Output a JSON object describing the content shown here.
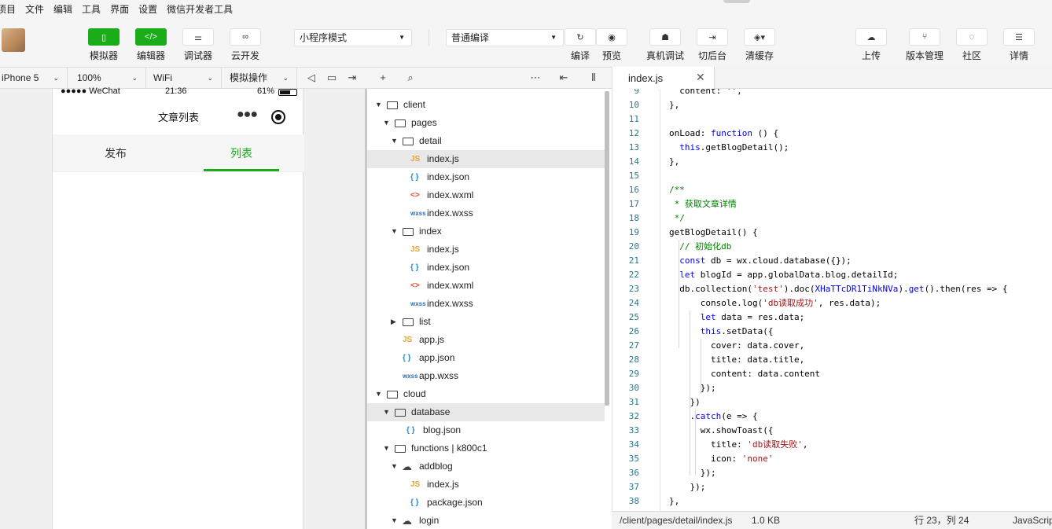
{
  "menu": [
    "项目",
    "文件",
    "编辑",
    "工具",
    "界面",
    "设置",
    "微信开发者工具"
  ],
  "toolbar": {
    "simulator": "模拟器",
    "editor": "编辑器",
    "debugger": "调试器",
    "cloud": "云开发",
    "mode": "小程序模式",
    "compile_mode": "普通编译",
    "compile": "编译",
    "preview": "预览",
    "real_debug": "真机调试",
    "background": "切后台",
    "clear_cache": "清缓存",
    "upload": "上传",
    "version": "版本管理",
    "community": "社区",
    "details": "详情"
  },
  "subbar": {
    "device": "iPhone 5",
    "zoom": "100%",
    "network": "WiFi",
    "operation": "模拟操作"
  },
  "phone": {
    "carrier": "●●●●● WeChat",
    "time": "21:36",
    "battery": "61%",
    "title": "文章列表",
    "tabs": [
      "发布",
      "列表"
    ],
    "active_tab": 1
  },
  "tree": [
    {
      "name": "client",
      "type": "folder",
      "depth": 0,
      "open": true
    },
    {
      "name": "pages",
      "type": "folder",
      "depth": 1,
      "open": true
    },
    {
      "name": "detail",
      "type": "folder",
      "depth": 2,
      "open": true
    },
    {
      "name": "index.js",
      "type": "js",
      "depth": 3,
      "selected": true
    },
    {
      "name": "index.json",
      "type": "json",
      "depth": 3
    },
    {
      "name": "index.wxml",
      "type": "wxml",
      "depth": 3
    },
    {
      "name": "index.wxss",
      "type": "wxss",
      "depth": 3
    },
    {
      "name": "index",
      "type": "folder",
      "depth": 2,
      "open": true
    },
    {
      "name": "index.js",
      "type": "js",
      "depth": 3
    },
    {
      "name": "index.json",
      "type": "json",
      "depth": 3
    },
    {
      "name": "index.wxml",
      "type": "wxml",
      "depth": 3
    },
    {
      "name": "index.wxss",
      "type": "wxss",
      "depth": 3
    },
    {
      "name": "list",
      "type": "folder",
      "depth": 2,
      "open": false
    },
    {
      "name": "app.js",
      "type": "js",
      "depth": 2
    },
    {
      "name": "app.json",
      "type": "json",
      "depth": 2
    },
    {
      "name": "app.wxss",
      "type": "wxss",
      "depth": 2
    },
    {
      "name": "cloud",
      "type": "folder",
      "depth": 0,
      "open": true
    },
    {
      "name": "database",
      "type": "folder",
      "depth": 1,
      "open": true,
      "highlight": true
    },
    {
      "name": "blog.json",
      "type": "json",
      "depth": 2.5
    },
    {
      "name": "functions | k800c1",
      "type": "cfolder",
      "depth": 1,
      "open": true
    },
    {
      "name": "addblog",
      "type": "cloudfn",
      "depth": 2,
      "open": true
    },
    {
      "name": "index.js",
      "type": "js",
      "depth": 3
    },
    {
      "name": "package.json",
      "type": "json",
      "depth": 3
    },
    {
      "name": "login",
      "type": "cloudfn",
      "depth": 2,
      "open": true
    }
  ],
  "icons": {
    "js": "JS",
    "json": "{ }",
    "wxml": "<>",
    "wxss": "wxss"
  },
  "editor": {
    "tab": "index.js",
    "lines": [
      {
        "n": "9",
        "html": "  content: '',"
      },
      {
        "n": "10",
        "html": "},"
      },
      {
        "n": "11",
        "html": ""
      },
      {
        "n": "12",
        "html": "onLoad: <span class='kw'>function</span> () {"
      },
      {
        "n": "13",
        "html": "  <span class='kw'>this</span>.getBlogDetail();"
      },
      {
        "n": "14",
        "html": "},"
      },
      {
        "n": "15",
        "html": ""
      },
      {
        "n": "16",
        "html": "<span class='cm'>/**</span>"
      },
      {
        "n": "17",
        "html": "<span class='cm'> * 获取文章详情</span>"
      },
      {
        "n": "18",
        "html": "<span class='cm'> */</span>"
      },
      {
        "n": "19",
        "html": "getBlogDetail() {"
      },
      {
        "n": "20",
        "html": "  <span class='cm'>// 初始化db</span>"
      },
      {
        "n": "21",
        "html": "  <span class='kw'>const</span> db = wx.cloud.database({});"
      },
      {
        "n": "22",
        "html": "  <span class='kw'>let</span> blogId = app.globalData.blog.detailId;"
      },
      {
        "n": "23",
        "html": "  db.collection(<span class='str'>'test'</span>).doc(<span class='kw'>XHaTTcDR1TiNkNVa</span>).<span class='kw'>get</span>().then(res => {"
      },
      {
        "n": "24",
        "html": "      console.log(<span class='str'>'db读取成功'</span>, res.data);"
      },
      {
        "n": "25",
        "html": "      <span class='kw'>let</span> data = res.data;"
      },
      {
        "n": "26",
        "html": "      <span class='kw'>this</span>.setData({"
      },
      {
        "n": "27",
        "html": "        cover: data.cover,"
      },
      {
        "n": "28",
        "html": "        title: data.title,"
      },
      {
        "n": "29",
        "html": "        content: data.content"
      },
      {
        "n": "30",
        "html": "      });"
      },
      {
        "n": "31",
        "html": "    })"
      },
      {
        "n": "32",
        "html": "    .<span class='kw'>catch</span>(e => {"
      },
      {
        "n": "33",
        "html": "      wx.showToast({"
      },
      {
        "n": "34",
        "html": "        title: <span class='str'>'db读取失败'</span>,"
      },
      {
        "n": "35",
        "html": "        icon: <span class='str'>'none'</span>"
      },
      {
        "n": "36",
        "html": "      });"
      },
      {
        "n": "37",
        "html": "    });"
      },
      {
        "n": "38",
        "html": "},"
      }
    ]
  },
  "status": {
    "path": "/client/pages/detail/index.js",
    "size": "1.0 KB",
    "position": "行 23，列 24",
    "language": "JavaScript"
  },
  "colors": {
    "accent": "#1aad19",
    "js_icon": "#e6a23c",
    "json_icon": "#2b8ad8",
    "wxml_icon": "#e44d26",
    "wxss_icon": "#2b6fb6"
  }
}
